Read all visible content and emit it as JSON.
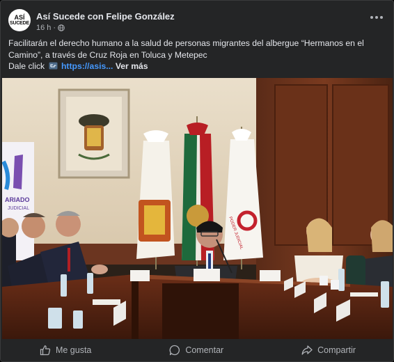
{
  "post": {
    "author": "Así Sucede con Felipe González",
    "avatar_text_top": "ASÍ",
    "avatar_text_bottom": "SUCEDE",
    "time": "16 h",
    "separator": "·",
    "privacy_icon": "globe-icon",
    "more_icon": "more-options-icon",
    "text_line1": "Facilitarán el derecho humano a la salud de personas migrantes del albergue “Hermanos en el",
    "text_line2": "Camino”, a través de Cruz Roja en Toluca y Metepec",
    "text_line3_prefix": "Dale click",
    "link_icon": "pointing-finger-icon",
    "link_text": "https://asis...",
    "see_more": "Ver más"
  },
  "photo": {
    "banner_text_1": "ARIADO",
    "banner_text_2": "JUDICIAL",
    "flag_text": "PODER JUDICIAL"
  },
  "actions": {
    "like": "Me gusta",
    "comment": "Comentar",
    "share": "Compartir"
  },
  "colors": {
    "background": "#242526",
    "text": "#e4e6eb",
    "secondary_text": "#b0b3b8",
    "link": "#4599ff"
  }
}
